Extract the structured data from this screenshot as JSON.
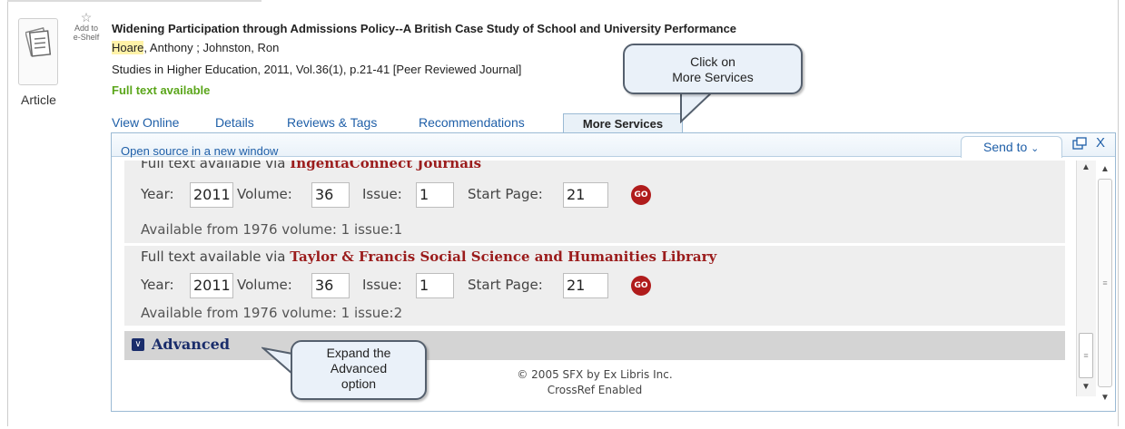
{
  "record": {
    "type_label": "Article",
    "eshelf_label": "Add to e-Shelf",
    "title": "Widening Participation through Admissions Policy--A British Case Study of School and University Performance",
    "author_highlight": "Hoare",
    "author_rest": ", Anthony ; Johnston, Ron",
    "source": "Studies in Higher Education, 2011, Vol.36(1), p.21-41 [Peer Reviewed Journal]",
    "fulltext": "Full text available"
  },
  "tabs": [
    "View Online",
    "Details",
    "Reviews & Tags",
    "Recommendations",
    "More Services"
  ],
  "panel": {
    "open_source": "Open source in a new window",
    "send_to": "Send to",
    "close": "X"
  },
  "services": [
    {
      "via_prefix": "Full text available via",
      "provider": "IngentaConnect Journals",
      "year_label": "Year:",
      "year": "2011",
      "volume_label": "Volume:",
      "volume": "36",
      "issue_label": "Issue:",
      "issue": "1",
      "start_label": "Start Page:",
      "start": "21",
      "go": "GO",
      "availability": "Available from 1976 volume: 1 issue:1"
    },
    {
      "via_prefix": "Full text available via",
      "provider": "Taylor & Francis Social Science and Humanities Library",
      "year_label": "Year:",
      "year": "2011",
      "volume_label": "Volume:",
      "volume": "36",
      "issue_label": "Issue:",
      "issue": "1",
      "start_label": "Start Page:",
      "start": "21",
      "go": "GO",
      "availability": "Available from 1976 volume: 1 issue:2"
    }
  ],
  "advanced": {
    "label": "Advanced",
    "icon": "double-chevron-down-icon"
  },
  "footer": {
    "copyright": "© 2005 SFX by Ex Libris Inc.",
    "crossref": "CrossRef Enabled"
  },
  "callouts": {
    "more_services_line1": "Click on",
    "more_services_line2": "More Services",
    "advanced_line1": "Expand the",
    "advanced_line2": "Advanced",
    "advanced_line3": "option"
  },
  "colors": {
    "link": "#1f5fa8",
    "fulltext": "#5ba61b",
    "provider": "#9b1c1c",
    "go": "#b01c1c",
    "advanced": "#1a2d6b"
  }
}
